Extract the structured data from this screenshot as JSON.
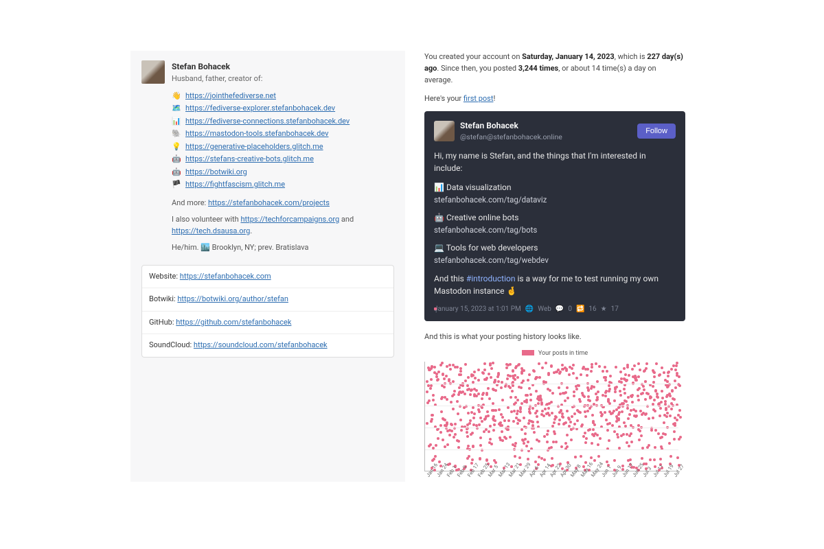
{
  "profile": {
    "name": "Stefan Bohacek",
    "tagline": "Husband, father, creator of:",
    "links": [
      {
        "emoji": "👋",
        "url": "https://jointhefediverse.net"
      },
      {
        "emoji": "🗺️",
        "url": "https://fediverse-explorer.stefanbohacek.dev"
      },
      {
        "emoji": "📊",
        "url": "https://fediverse-connections.stefanbohacek.dev"
      },
      {
        "emoji": "🐘",
        "url": "https://mastodon-tools.stefanbohacek.dev"
      },
      {
        "emoji": "💡",
        "url": "https://generative-placeholders.glitch.me"
      },
      {
        "emoji": "🤖",
        "url": "https://stefans-creative-bots.glitch.me"
      },
      {
        "emoji": "🤖",
        "url": "https://botwiki.org"
      },
      {
        "emoji": "🏴",
        "url": "https://fightfascism.glitch.me"
      }
    ],
    "more_prefix": "And more: ",
    "more_link": "https://stefanbohacek.com/projects",
    "volunteer_prefix": "I also volunteer with ",
    "volunteer_link1": "https://techforcampaigns.org",
    "volunteer_mid": " and ",
    "volunteer_link2": "https://tech.dsausa.org",
    "volunteer_suffix": ".",
    "footer": "He/him. 🏙️ Brooklyn, NY; prev. Bratislava",
    "meta": [
      {
        "label": "Website:",
        "url": "https://stefanbohacek.com"
      },
      {
        "label": "Botwiki:",
        "url": "https://botwiki.org/author/stefan"
      },
      {
        "label": "GitHub:",
        "url": "https://github.com/stefanbohacek"
      },
      {
        "label": "SoundCloud:",
        "url": "https://soundcloud.com/stefanbohacek"
      }
    ]
  },
  "stats": {
    "intro_1": "You created your account on ",
    "created_date": "Saturday, January 14, 2023",
    "intro_2": ", which is ",
    "days_ago": "227 day(s) ago",
    "intro_3": ". Since then, you posted ",
    "post_count": "3,244 times",
    "intro_4": ", or about 14 time(s) a day on average.",
    "first_post_lead": "Here's your ",
    "first_post_link": "first post",
    "first_post_tail": "!",
    "history_lead": "And this is what your posting history looks like."
  },
  "post": {
    "name": "Stefan Bohacek",
    "handle": "@stefan@stefanbohacek.online",
    "follow": "Follow",
    "line1": "Hi, my name is Stefan, and the things that I'm interested in include:",
    "interests": [
      {
        "emoji": "📊",
        "title": "Data visualization",
        "url": "stefanbohacek.com/tag/dataviz"
      },
      {
        "emoji": "🤖",
        "title": "Creative online bots",
        "url": "stefanbohacek.com/tag/bots"
      },
      {
        "emoji": "💻",
        "title": "Tools for web developers",
        "url": "stefanbohacek.com/tag/webdev"
      }
    ],
    "outro_a": "And this ",
    "outro_hash": "#introduction",
    "outro_b": " is a way for me to test running my own Mastodon instance 🤞",
    "meta_date": "January 15, 2023 at 1:01 PM",
    "meta_client": "Web",
    "meta_replies": "0",
    "meta_boosts": "16",
    "meta_favs": "17"
  },
  "chart_data": {
    "type": "scatter",
    "title": "Your posts in time",
    "legend": "Your posts in time",
    "x_ticks": [
      "Jan 16",
      "Jan 24",
      "Feb 1",
      "Feb 9",
      "Feb 17",
      "Feb 25",
      "Mar 5",
      "Mar 13",
      "Mar 21",
      "Mar 29",
      "Apr 6",
      "Apr 14",
      "Apr 22",
      "Apr 30",
      "May 8",
      "May 16",
      "May 24",
      "Jun 1",
      "Jun 9",
      "Jun 17",
      "Jun 25",
      "Jul 3",
      "Jul 11",
      "Jul 19",
      "Jul 27"
    ],
    "xlabel": "",
    "ylabel": "",
    "note": "Dense scatter of ~3,244 posts across Jan 16 – Jul 27 2023 by time of day; approx 14 posts/day, heavier in upper half (daytime hours), sparse band near bottom."
  }
}
